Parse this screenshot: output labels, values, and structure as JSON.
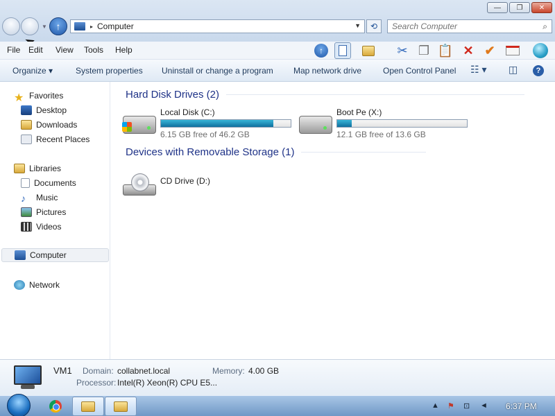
{
  "window": {
    "minimize_glyph": "—",
    "maximize_glyph": "❐",
    "close_glyph": "✕"
  },
  "address_bar": {
    "separator": "▸",
    "path": "Computer",
    "dropdown_glyph": "▼"
  },
  "refresh_glyph": "⟲",
  "search": {
    "placeholder": "Search Computer",
    "icon_glyph": "⌕"
  },
  "menu": {
    "file": "File",
    "edit": "Edit",
    "view": "View",
    "tools": "Tools",
    "help": "Help"
  },
  "toolbar_icons": [
    "up-arrow-icon",
    "preview-pane-icon",
    "properties-folder-icon",
    "cut-icon",
    "copy-icon",
    "paste-icon",
    "delete-icon",
    "checkmark-icon",
    "email-icon",
    "globe-icon"
  ],
  "commands": {
    "organize": "Organize ▾",
    "system_properties": "System properties",
    "uninstall": "Uninstall or change a program",
    "map_network_drive": "Map network drive",
    "open_control_panel": "Open Control Panel",
    "views_glyph": "☷ ▾",
    "preview_glyph": "◫",
    "help_glyph": "?"
  },
  "navigation": {
    "favorites": "Favorites",
    "desktop": "Desktop",
    "downloads": "Downloads",
    "recent_places": "Recent Places",
    "libraries": "Libraries",
    "documents": "Documents",
    "music": "Music",
    "pictures": "Pictures",
    "videos": "Videos",
    "computer": "Computer",
    "network": "Network"
  },
  "groups": {
    "hard_disk": "Hard Disk Drives (2)",
    "removable": "Devices with Removable Storage (1)"
  },
  "drives": {
    "local_disk": {
      "name": "Local Disk (C:)",
      "free_text": "6.15 GB free of 46.2 GB",
      "used_fraction": 0.867
    },
    "boot_pe": {
      "name": "Boot Pe (X:)",
      "free_text": "12.1 GB free of 13.6 GB",
      "used_fraction": 0.11
    },
    "cd_drive": {
      "name": "CD Drive (D:)"
    }
  },
  "details": {
    "computer_name": "VM1",
    "domain_label": "Domain:",
    "domain_value": "collabnet.local",
    "memory_label": "Memory:",
    "memory_value": "4.00 GB",
    "processor_label": "Processor:",
    "processor_value": "Intel(R) Xeon(R) CPU E5..."
  },
  "taskbar": {
    "tray_show_hidden": "▲",
    "tray_flag": "⚑",
    "tray_network": "⊡",
    "tray_volume": "◄",
    "clock": "6:37 PM"
  },
  "colors": {
    "drive_bar_fill": "#1a8fb8",
    "group_header": "#1e3287",
    "taskbar": "#8bb0d8"
  }
}
